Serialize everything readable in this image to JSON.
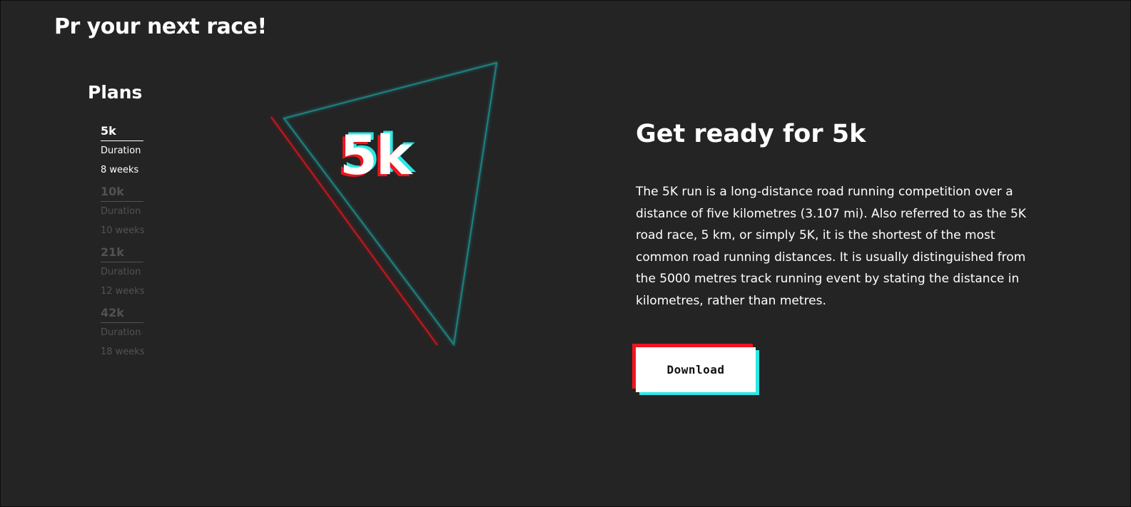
{
  "page": {
    "title": "Pr your next race!"
  },
  "plans": {
    "title": "Plans",
    "items": [
      {
        "name": "5k",
        "duration_label": "Duration",
        "duration_value": "8 weeks",
        "active": true
      },
      {
        "name": "10k",
        "duration_label": "Duration",
        "duration_value": "10 weeks",
        "active": false
      },
      {
        "name": "21k",
        "duration_label": "Duration",
        "duration_value": "12 weeks",
        "active": false
      },
      {
        "name": "42k",
        "duration_label": "Duration",
        "duration_value": "18 weeks",
        "active": false
      }
    ]
  },
  "hero": {
    "label": "5k"
  },
  "detail": {
    "headline": "Get ready for 5k",
    "description": "The 5K run is a long-distance road running competition over a distance of five kilometres (3.107 mi). Also referred to as the 5K road race, 5 km, or simply 5K, it is the shortest of the most common road running distances. It is usually distinguished from the 5000 metres track running event by stating the distance in kilometres, rather than metres.",
    "download_label": "Download"
  },
  "colors": {
    "background": "#242424",
    "accent_red": "#f0141e",
    "accent_cyan": "#2de6e6",
    "text": "#ffffff",
    "muted": "#525252"
  },
  "icons": {
    "graphic": "glitch-triangle-icon"
  }
}
